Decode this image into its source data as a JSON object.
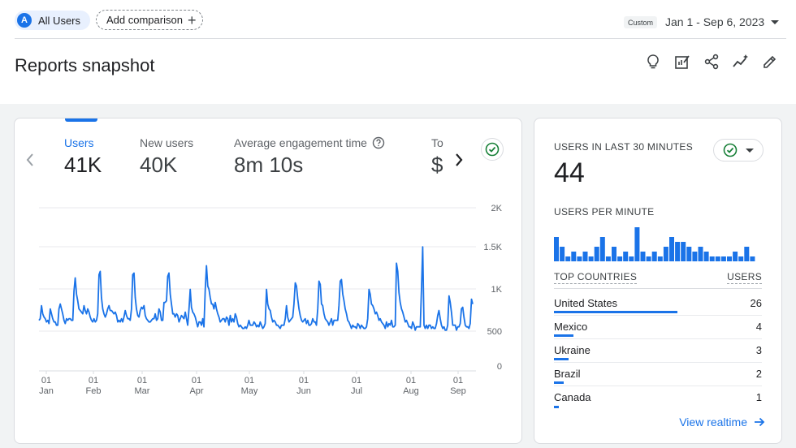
{
  "topbar": {
    "segment_letter": "A",
    "segment_label": "All Users",
    "add_comparison_label": "Add comparison",
    "date_chip": "Custom",
    "date_range": "Jan 1 - Sep 6, 2023"
  },
  "header": {
    "title": "Reports snapshot",
    "tools": [
      "lightbulb-icon",
      "customize-report-icon",
      "share-icon",
      "insights-icon",
      "edit-icon"
    ]
  },
  "metrics": [
    {
      "label": "Users",
      "value": "41K",
      "active": true
    },
    {
      "label": "New users",
      "value": "40K",
      "active": false
    },
    {
      "label": "Average engagement time",
      "value": "8m 10s",
      "active": false
    },
    {
      "label": "To",
      "value": "$",
      "active": false
    }
  ],
  "colors": {
    "accent": "#1a73e8",
    "success": "#188038"
  },
  "chart_data": {
    "type": "line",
    "series": [
      {
        "values": [
          620,
          640,
          800,
          700,
          660,
          640,
          600,
          620,
          580,
          760,
          700,
          640,
          600,
          600,
          560,
          560,
          760,
          820,
          760,
          700,
          620,
          580,
          640,
          620,
          640,
          640,
          620,
          620,
          980,
          1140,
          940,
          860,
          760,
          740,
          720,
          700,
          800,
          740,
          700,
          760,
          720,
          660,
          620,
          600,
          640,
          600,
          620,
          700,
          1180,
          1220,
          900,
          760,
          700,
          660,
          700,
          760,
          800,
          740,
          740,
          720,
          700,
          720,
          680,
          600,
          620,
          600,
          640,
          600,
          660,
          740,
          680,
          640,
          640,
          620,
          760,
          1180,
          1200,
          900,
          760,
          680,
          660,
          740,
          780,
          760,
          800,
          680,
          640,
          620,
          600,
          600,
          620,
          640,
          640,
          700,
          620,
          640,
          760,
          720,
          620,
          620,
          840,
          840,
          860,
          1160,
          1200,
          940,
          820,
          700,
          700,
          660,
          700,
          680,
          600,
          640,
          680,
          660,
          640,
          720,
          640,
          560,
          760,
          1000,
          780,
          720,
          700,
          660,
          600,
          540,
          600,
          600,
          560,
          640,
          540,
          1000,
          1290,
          1040,
          1000,
          900,
          820,
          820,
          760,
          840,
          760,
          700,
          660,
          600,
          620,
          640,
          640,
          600,
          660,
          640,
          560,
          680,
          600,
          640,
          600,
          700,
          660,
          580,
          540,
          560,
          540,
          520,
          520,
          540,
          520,
          560,
          620,
          560,
          560,
          560,
          600,
          580,
          540,
          560,
          540,
          600,
          560,
          520,
          540,
          580,
          1000,
          820,
          760,
          740,
          660,
          600,
          620,
          600,
          560,
          560,
          540,
          520,
          560,
          560,
          560,
          640,
          800,
          660,
          600,
          620,
          640,
          660,
          820,
          1080,
          1040,
          880,
          760,
          680,
          620,
          600,
          620,
          640,
          580,
          620,
          560,
          560,
          580,
          640,
          600,
          600,
          560,
          760,
          1100,
          1060,
          820,
          800,
          700,
          640,
          620,
          600,
          560,
          600,
          640,
          560,
          620,
          620,
          620,
          620,
          800,
          1100,
          1120,
          940,
          860,
          760,
          700,
          620,
          600,
          560,
          520,
          560,
          540,
          540,
          520,
          580,
          560,
          520,
          560,
          540,
          520,
          520,
          540,
          640,
          1000,
          940,
          820,
          800,
          760,
          700,
          720,
          680,
          620,
          640,
          600,
          580,
          560,
          520,
          600,
          540,
          580,
          560,
          620,
          540,
          540,
          560,
          1320,
          1220,
          960,
          840,
          760,
          720,
          660,
          600,
          620,
          580,
          540,
          540,
          520,
          600,
          560,
          500,
          540,
          540,
          540,
          540,
          1000,
          1520,
          560,
          520,
          560,
          520,
          560,
          560,
          520,
          540,
          520,
          520,
          580,
          680,
          740,
          640,
          560,
          520,
          540,
          500,
          500,
          560,
          920,
          840,
          720,
          560,
          560,
          560,
          500,
          540,
          540,
          580,
          760,
          780,
          660,
          560,
          540,
          540,
          520,
          580,
          880,
          820
        ],
        "values_comment_none": null
      }
    ],
    "x_ticks": [
      {
        "day": "01",
        "month": "Jan"
      },
      {
        "day": "01",
        "month": "Feb"
      },
      {
        "day": "01",
        "month": "Mar"
      },
      {
        "day": "01",
        "month": "Apr"
      },
      {
        "day": "01",
        "month": "May"
      },
      {
        "day": "01",
        "month": "Jun"
      },
      {
        "day": "01",
        "month": "Jul"
      },
      {
        "day": "01",
        "month": "Aug"
      },
      {
        "day": "01",
        "month": "Sep"
      }
    ],
    "y_ticks": [
      "2K",
      "1.5K",
      "1K",
      "500",
      "0"
    ],
    "ylim": [
      0,
      2000
    ],
    "grid": true,
    "color": "#1a73e8"
  },
  "realtime": {
    "title": "USERS IN LAST 30 MINUTES",
    "value": "44",
    "per_minute_label": "USERS PER MINUTE",
    "per_minute_values": [
      5,
      3,
      1,
      2,
      1,
      2,
      1,
      3,
      5,
      1,
      3,
      1,
      2,
      1,
      7,
      2,
      1,
      2,
      1,
      3,
      5,
      4,
      4,
      3,
      2,
      3,
      2,
      1,
      1,
      1,
      1,
      2,
      1,
      3,
      1
    ],
    "countries_header": "TOP COUNTRIES",
    "users_header": "USERS",
    "countries": [
      {
        "name": "United States",
        "value": "26",
        "share": 1.0
      },
      {
        "name": "Mexico",
        "value": "4",
        "share": 0.16
      },
      {
        "name": "Ukraine",
        "value": "3",
        "share": 0.12
      },
      {
        "name": "Brazil",
        "value": "2",
        "share": 0.08
      },
      {
        "name": "Canada",
        "value": "1",
        "share": 0.04
      }
    ],
    "view_link": "View realtime"
  }
}
